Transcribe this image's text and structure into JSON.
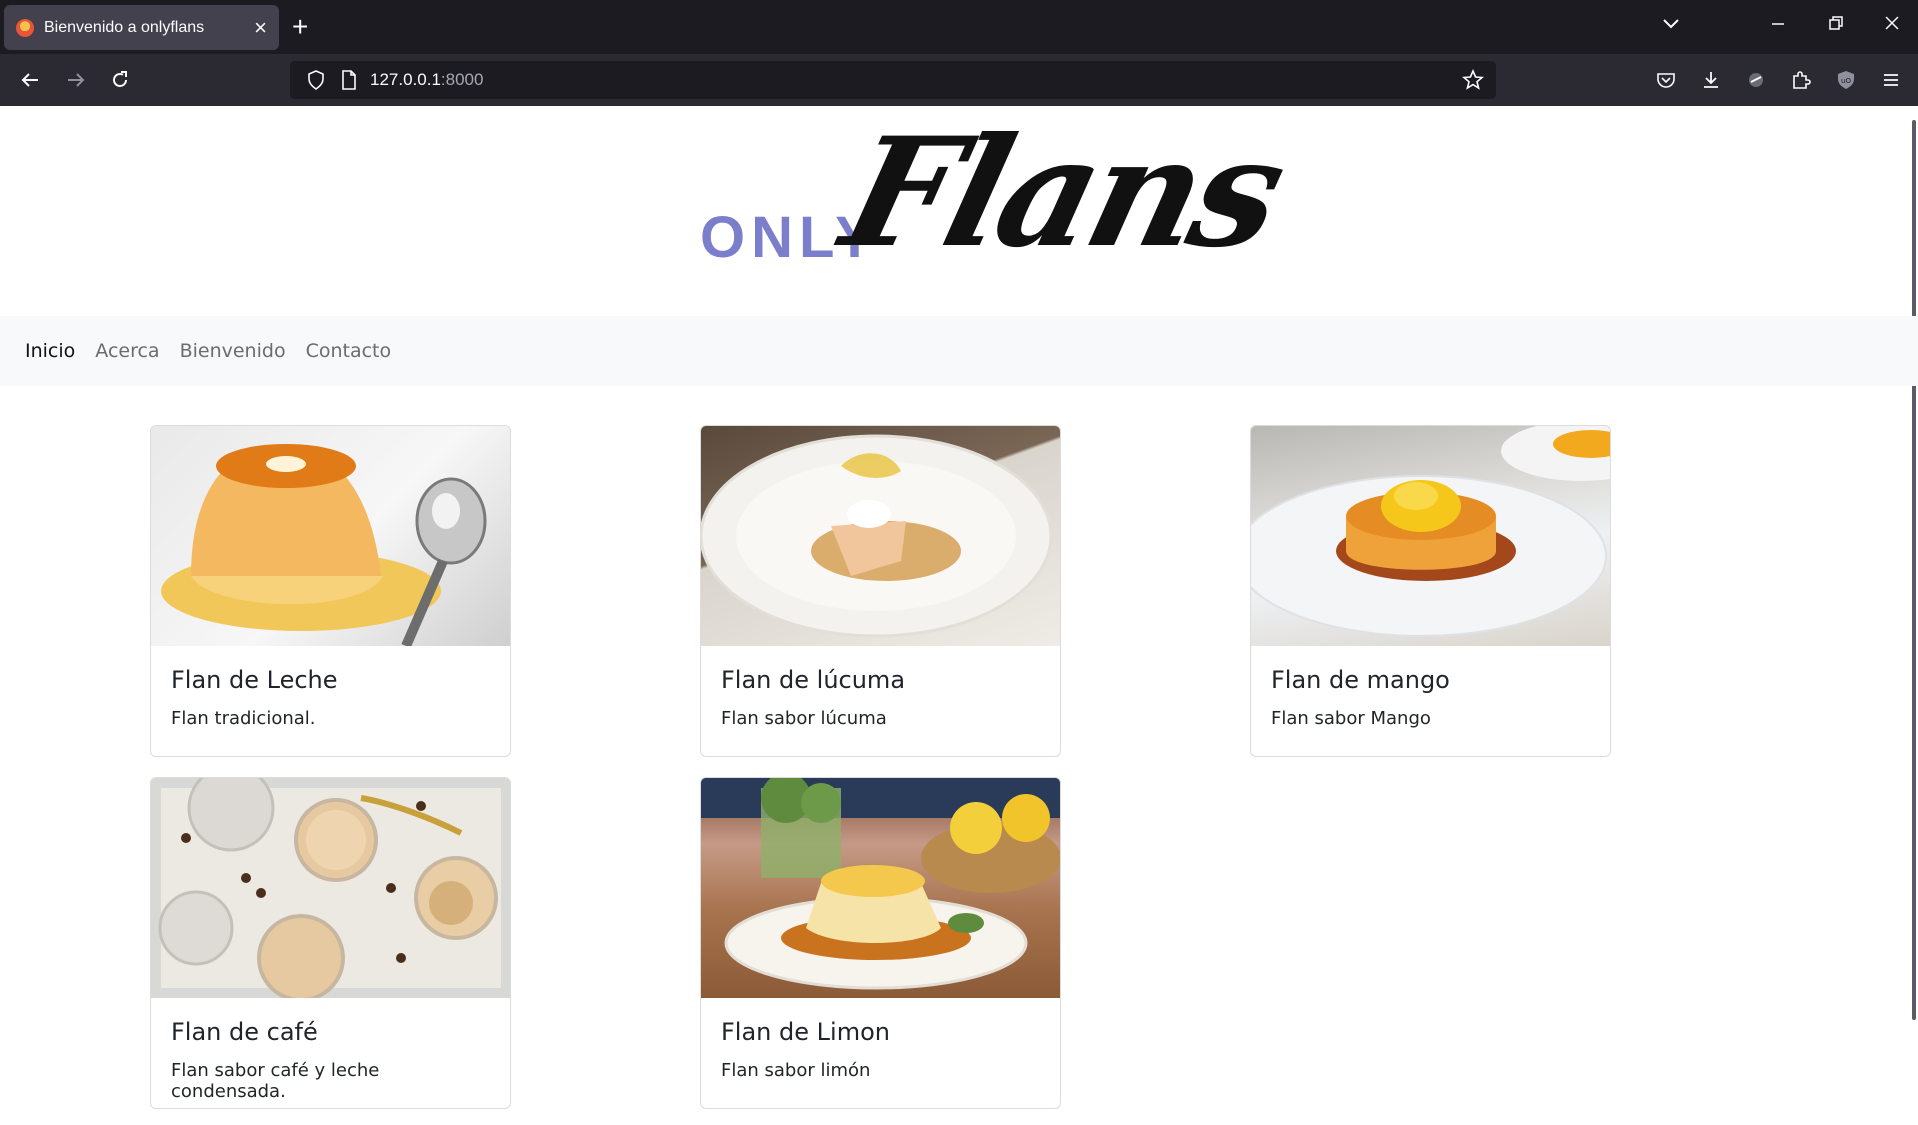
{
  "browser": {
    "tab_title": "Bienvenido a onlyflans",
    "url_host": "127.0.0.1",
    "url_port": ":8000"
  },
  "logo": {
    "prefix": "ONLY",
    "wordmark": "Flans"
  },
  "nav": {
    "items": [
      {
        "label": "Inicio",
        "active": true
      },
      {
        "label": "Acerca",
        "active": false
      },
      {
        "label": "Bienvenido",
        "active": false
      },
      {
        "label": "Contacto",
        "active": false
      }
    ]
  },
  "cards": [
    {
      "title": "Flan de Leche",
      "text": "Flan tradicional."
    },
    {
      "title": "Flan de lúcuma",
      "text": "Flan sabor lúcuma"
    },
    {
      "title": "Flan de mango",
      "text": "Flan sabor Mango"
    },
    {
      "title": "Flan de café",
      "text": "Flan sabor café y leche condensada."
    },
    {
      "title": "Flan de Limon",
      "text": "Flan sabor limón"
    }
  ],
  "colors": {
    "logo_accent": "#7b7ecb",
    "chrome_dark": "#1c1b22",
    "toolbar": "#2b2a33",
    "navbar_bg": "#f8f9fa"
  }
}
